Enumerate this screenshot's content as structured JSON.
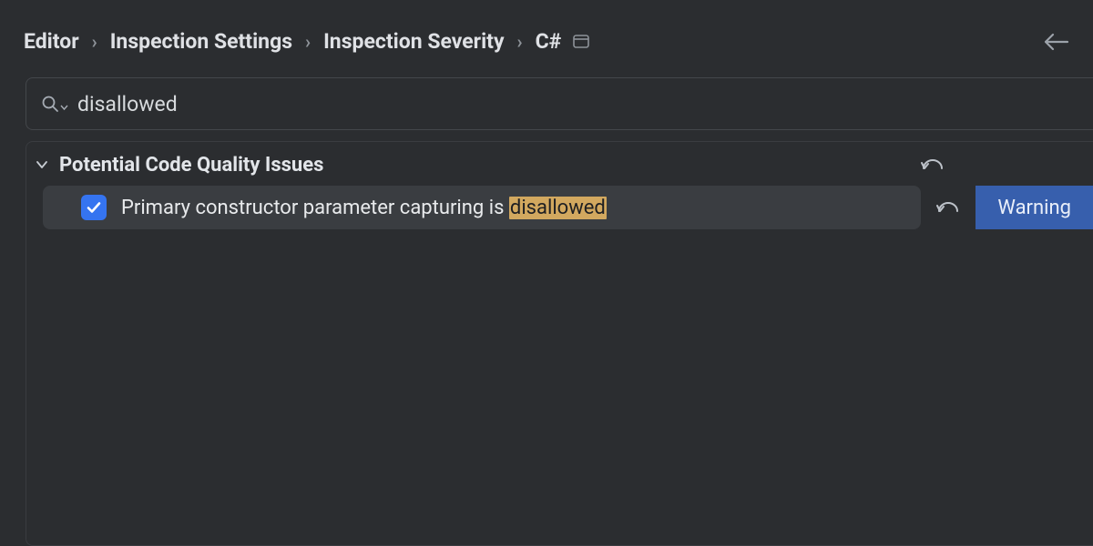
{
  "breadcrumbs": {
    "items": [
      {
        "label": "Editor"
      },
      {
        "label": "Inspection Settings"
      },
      {
        "label": "Inspection Severity"
      },
      {
        "label": "C#"
      }
    ]
  },
  "search": {
    "value": "disallowed",
    "placeholder": ""
  },
  "results": {
    "category": {
      "label": "Potential Code Quality Issues"
    },
    "item": {
      "prefix": "Primary constructor parameter capturing is ",
      "highlight": "disallowed",
      "severity": "Warning",
      "checked": true
    }
  }
}
